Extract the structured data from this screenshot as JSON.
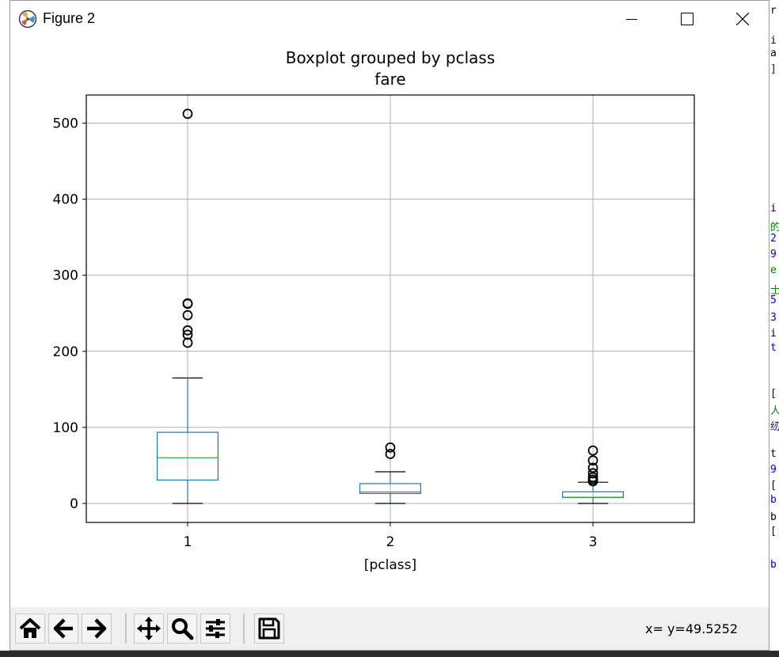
{
  "window": {
    "title": "Figure 2",
    "controls": [
      "minimize",
      "maximize",
      "close"
    ]
  },
  "chart_data": {
    "type": "box",
    "title": "Boxplot grouped by pclass",
    "subtitle": "fare",
    "xlabel": "[pclass]",
    "ylabel": "",
    "categories": [
      "1",
      "2",
      "3"
    ],
    "yticks": [
      "0",
      "100",
      "200",
      "300",
      "400",
      "500"
    ],
    "ylim": [
      -25,
      537
    ],
    "grid": true,
    "boxes": [
      {
        "category": "1",
        "whisker_low": 0,
        "q1": 30.7,
        "median": 60,
        "q3": 93.5,
        "whisker_high": 164.9,
        "outliers": [
          211.3,
          221.8,
          227.5,
          247.5,
          262.4,
          263,
          512.3
        ]
      },
      {
        "category": "2",
        "whisker_low": 0,
        "q1": 13,
        "median": 15,
        "q3": 26,
        "whisker_high": 41.6,
        "outliers": [
          65,
          73.5
        ]
      },
      {
        "category": "3",
        "whisker_low": 0,
        "q1": 7.75,
        "median": 8.05,
        "q3": 15.25,
        "whisker_high": 27.9,
        "outliers": [
          29.1,
          31.3,
          34.4,
          39.7,
          46.9,
          56.5,
          69.6
        ]
      }
    ],
    "colors": {
      "box": "#1f77b4",
      "median": "#2ca02c",
      "whisker": "#1f77b4",
      "cap": "#000000",
      "outlier": "#000000",
      "grid": "#b0b0b0"
    }
  },
  "toolbar": {
    "buttons": [
      "home-icon",
      "back-arrow-icon",
      "forward-arrow-icon",
      "pan-icon",
      "zoom-icon",
      "configure-subplots-icon",
      "save-icon"
    ],
    "coords": "x= y=49.5252"
  },
  "background_text_strip": [
    {
      "text": "r",
      "color": "#000000"
    },
    {
      "text": "i",
      "color": "#000000"
    },
    {
      "text": "a",
      "color": "#000000"
    },
    {
      "text": "]",
      "color": "#0000cc"
    },
    {
      "text": "i",
      "color": "#000000"
    },
    {
      "text": "的",
      "color": "#008000"
    },
    {
      "text": "2",
      "color": "#0000cc"
    },
    {
      "text": "9",
      "color": "#0000cc"
    },
    {
      "text": "e",
      "color": "#008000"
    },
    {
      "text": "士",
      "color": "#008000"
    },
    {
      "text": "5",
      "color": "#0000cc"
    },
    {
      "text": "3",
      "color": "#0000cc"
    },
    {
      "text": "i",
      "color": "#000000"
    },
    {
      "text": "t",
      "color": "#0000cc"
    },
    {
      "text": "[",
      "color": "#000000"
    },
    {
      "text": "人",
      "color": "#008000"
    },
    {
      "text": "纫",
      "color": "#0000cc"
    },
    {
      "text": "t",
      "color": "#000000"
    },
    {
      "text": "9",
      "color": "#0000cc"
    },
    {
      "text": "[",
      "color": "#000000"
    },
    {
      "text": "b",
      "color": "#0000cc"
    },
    {
      "text": "b",
      "color": "#000000"
    },
    {
      "text": "[",
      "color": "#000000"
    },
    {
      "text": "b",
      "color": "#0000cc"
    }
  ]
}
